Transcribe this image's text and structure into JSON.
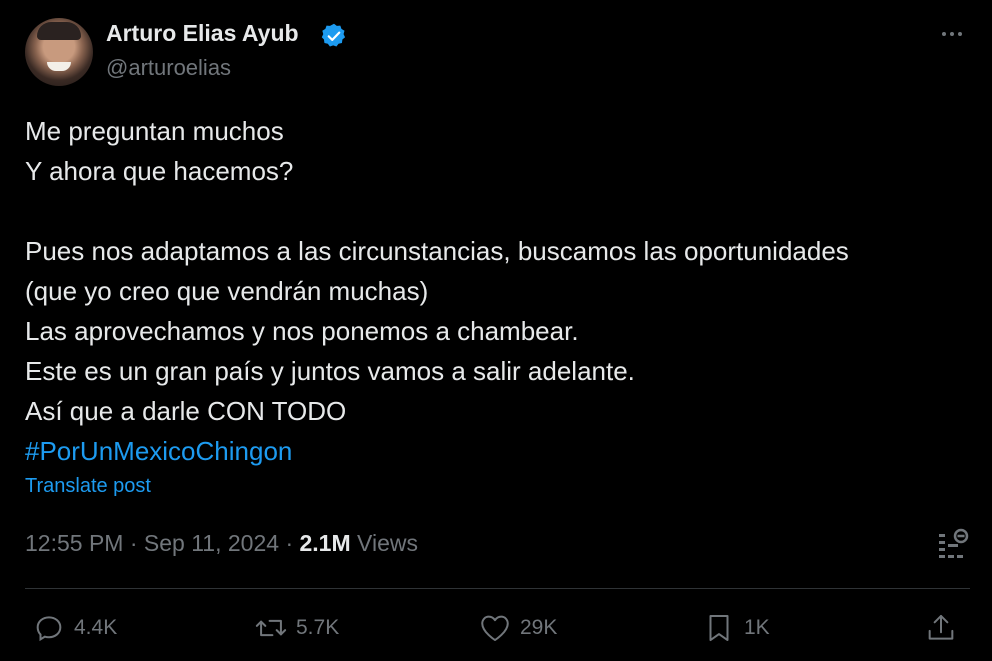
{
  "author": {
    "name": "Arturo Elias Ayub",
    "handle": "@arturoelias",
    "verified_color": "#1d9bf0"
  },
  "post": {
    "lines": [
      "Me preguntan muchos",
      "Y ahora que hacemos?",
      "",
      "Pues nos adaptamos a las circunstancias, buscamos las oportunidades",
      "(que yo creo que vendrán muchas)",
      "Las aprovechamos y nos ponemos a chambear.",
      "Este es un gran país y juntos vamos a salir adelante.",
      "Así que a darle CON TODO"
    ],
    "hashtag": "#PorUnMexicoChingon",
    "translate_label": "Translate post"
  },
  "meta": {
    "time": "12:55 PM",
    "separator": "·",
    "date": "Sep 11, 2024",
    "views_count": "2.1M",
    "views_label": "Views"
  },
  "actions": {
    "replies": "4.4K",
    "reposts": "5.7K",
    "likes": "29K",
    "bookmarks": "1K"
  },
  "colors": {
    "background": "#000000",
    "text": "#e7e9ea",
    "muted": "#71767b",
    "accent": "#1d9bf0",
    "divider": "#2f3336"
  },
  "icons": [
    "verified-badge-icon",
    "more-icon",
    "analytics-icon",
    "reply-icon",
    "repost-icon",
    "like-icon",
    "bookmark-icon",
    "share-icon"
  ]
}
